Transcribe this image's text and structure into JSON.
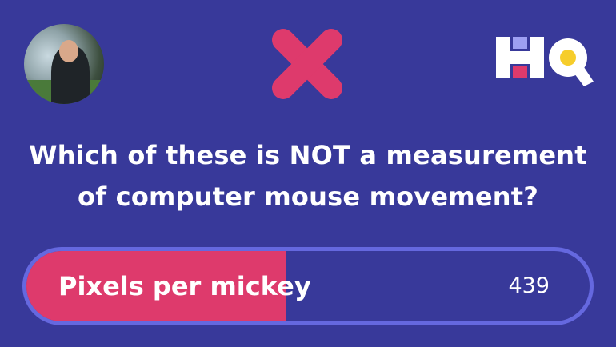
{
  "player": {
    "avatar_icon": "player-avatar-photo"
  },
  "result": {
    "icon": "wrong-x-icon",
    "color": "#de3a6c"
  },
  "brand": {
    "logo_text": "HQ"
  },
  "question": {
    "line1": "Which of these is NOT a measurement",
    "line2": "of computer mouse movement?"
  },
  "answer": {
    "label": "Pixels per mickey",
    "count": "439",
    "fill_fraction": 0.46,
    "fill_color": "#de3a6c",
    "border_color": "#6568df"
  },
  "colors": {
    "background": "#38399a"
  }
}
